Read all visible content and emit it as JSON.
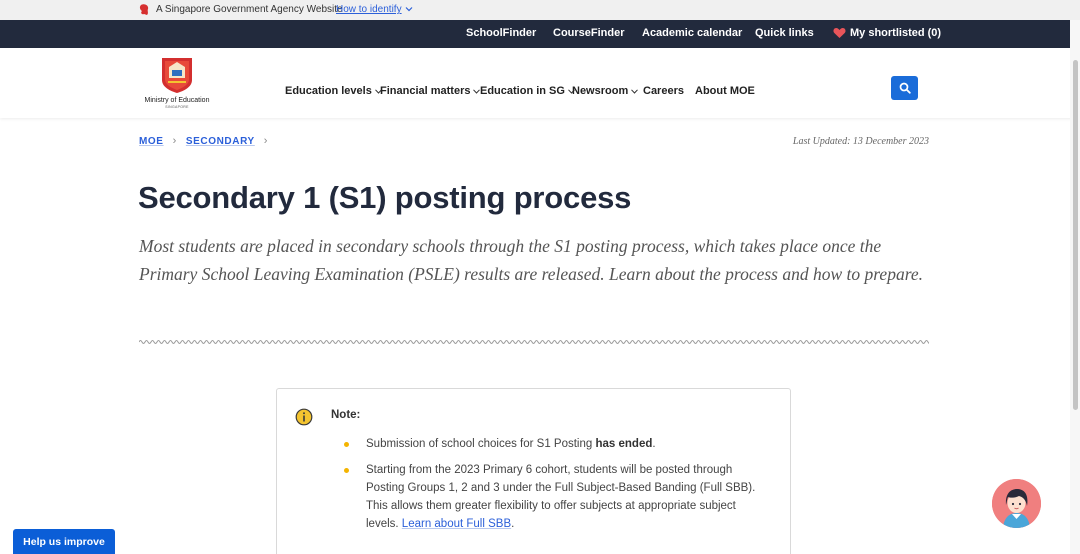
{
  "gov_banner": {
    "text": "A Singapore Government Agency Website",
    "link": "How to identify"
  },
  "topnav": {
    "items": [
      "SchoolFinder",
      "CourseFinder",
      "Academic calendar",
      "Quick links",
      "My shortlisted (0)"
    ]
  },
  "logo": {
    "name": "Ministry of Education",
    "sub": "SINGAPORE"
  },
  "mainnav": {
    "items": [
      "Education levels",
      "Financial matters",
      "Education in SG",
      "Newsroom",
      "Careers",
      "About MOE"
    ]
  },
  "breadcrumb": [
    "MOE",
    "SECONDARY"
  ],
  "last_updated": "Last Updated: 13 December 2023",
  "page_title": "Secondary 1 (S1) posting process",
  "lead": "Most students are placed in secondary schools through the S1 posting process, which takes place once the Primary School Leaving Examination (PSLE) results are released. Learn about the process and how to prepare.",
  "note": {
    "label": "Note:",
    "item1_text": "Submission of school choices for S1 Posting ",
    "item1_bold": "has ended",
    "item1_end": ".",
    "item2_text": "Starting from the 2023 Primary 6 cohort, students will be posted through Posting Groups 1, 2 and 3 under the Full Subject-Based Banding (Full SBB). This allows them greater flexibility to offer subjects at appropriate subject levels. ",
    "item2_link": "Learn about Full SBB",
    "item2_end": "."
  },
  "help_button": "Help us improve",
  "colors": {
    "topnav_bg": "#222a3d",
    "link_blue": "#2b5fd9",
    "search_btn": "#1a6cd9",
    "bullet": "#f4b400",
    "help_btn": "#0b5ed7",
    "chat_bg": "#f07f7f"
  },
  "icons": {
    "gov": "lion-head-icon",
    "heart": "heart-icon",
    "search": "search-icon",
    "note": "info-icon",
    "chat": "chatbot-avatar-icon"
  }
}
